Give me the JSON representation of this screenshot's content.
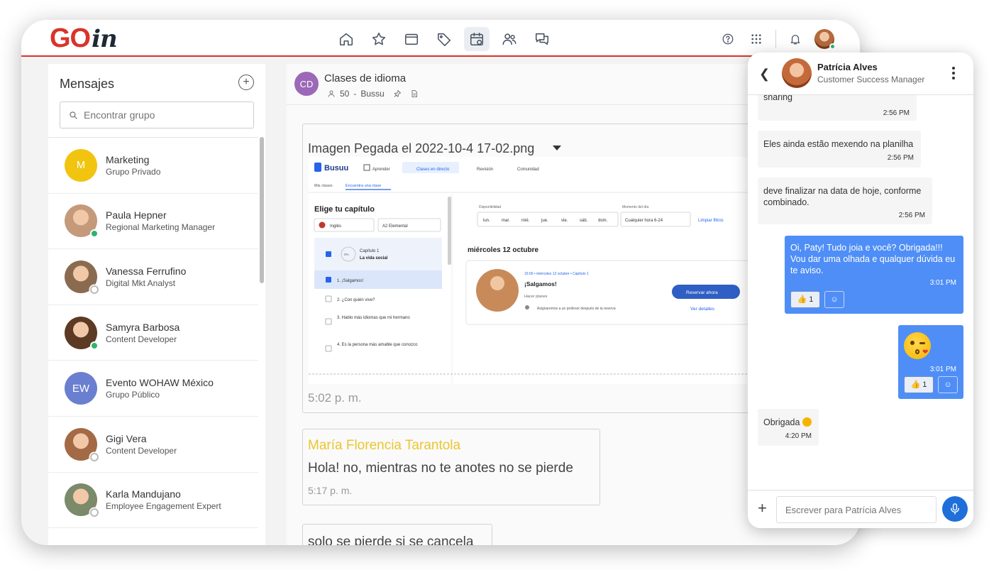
{
  "app": {
    "logo_go": "GO",
    "logo_in": "in",
    "nav": [
      "home-icon",
      "star-icon",
      "wallet-icon",
      "tag-icon",
      "calendar-icon",
      "people-icon",
      "chat-icon"
    ],
    "active_nav": "calendar-icon",
    "accent_color": "#d9342b"
  },
  "sidebar": {
    "title": "Mensajes",
    "search_placeholder": "Encontrar grupo",
    "items": [
      {
        "name": "Marketing",
        "sub": "Grupo Privado",
        "initials": "M",
        "color": "#f1c40f",
        "status": ""
      },
      {
        "name": "Paula Hepner",
        "sub": "Regional Marketing Manager",
        "initials": "",
        "color": "#c49a7a",
        "status": "online"
      },
      {
        "name": "Vanessa Ferrufino",
        "sub": "Digital Mkt Analyst",
        "initials": "",
        "color": "#8a6b4f",
        "status": "offline"
      },
      {
        "name": "Samyra Barbosa",
        "sub": "Content Developer",
        "initials": "",
        "color": "#5c3a24",
        "status": "online"
      },
      {
        "name": "Evento WOHAW México",
        "sub": "Grupo Público",
        "initials": "EW",
        "color": "#6a7fcf",
        "status": ""
      },
      {
        "name": "Gigi Vera",
        "sub": "Content Developer",
        "initials": "",
        "color": "#a36a45",
        "status": "offline"
      },
      {
        "name": "Karla Mandujano",
        "sub": "Employee Engagement Expert",
        "initials": "",
        "color": "#7b8a6a",
        "status": "offline"
      }
    ]
  },
  "conversation": {
    "avatar": "CD",
    "title": "Clases de idioma",
    "members": "50",
    "separator": "-",
    "partner": "Bussu",
    "image_message": {
      "filename": "Imagen Pegada el 2022-10-4 17-02.png",
      "time": "5:02 p. m.",
      "shot": {
        "brand": "Busuu",
        "tabs": [
          "Aprender",
          "Clases en directo",
          "Revisión",
          "Comunidad"
        ],
        "subtabs": [
          "Mis clases",
          "Encuentra una clase"
        ],
        "heading": "Elige tu capítulo",
        "lang": "Inglés",
        "level": "A2 Elemental",
        "chapter_pct": "0%",
        "chapter_title": "Capítulo 1",
        "chapter_sub": "La vida social",
        "lessons": [
          "1. ¡Salgamos!",
          "2. ¿Con quién vive?",
          "3. Hablo más idiomas que mi hermano",
          "4. Es la persona más amable que conozco"
        ],
        "filter_label_1": "Disponibilidad",
        "filter_label_2": "Momento del día",
        "days": [
          "lun.",
          "mar.",
          "mié.",
          "jue.",
          "vie.",
          "sáb.",
          "dom."
        ],
        "time_select": "Cualquier hora 6-24",
        "clear": "Limpiar filtros",
        "date": "miércoles 12 octubre",
        "class_meta": "16:00 • miércoles 12 octubre • Capítulo 1",
        "class_title": "¡Salgamos!",
        "class_sub": "Hacer planes",
        "class_note": "Asignaremos a un profesor después de la reserva",
        "book": "Reservar ahora",
        "details": "Ver detalles"
      }
    },
    "message2": {
      "author": "María Florencia Tarantola",
      "text": "Hola! no, mientras no te anotes no se pierde",
      "time": "5:17 p. m."
    },
    "message3": {
      "text": "solo se pierde si se cancela"
    }
  },
  "chat": {
    "name": "Patrícia Alves",
    "role": "Customer Success Manager",
    "input_placeholder": "Escrever para Patrícia Alves",
    "messages": [
      {
        "text": "sharing",
        "time": "2:56 PM",
        "mine": false
      },
      {
        "text": "Eles ainda estão mexendo na planilha",
        "time": "2:56 PM",
        "mine": false
      },
      {
        "text": "deve finalizar na data de hoje, conforme combinado.",
        "time": "2:56 PM",
        "mine": false
      },
      {
        "text": "Oi, Paty! Tudo joia e você? Obrigada!!! Vou dar uma olhada e qualquer dúvida eu te aviso.",
        "time": "3:01 PM",
        "mine": true,
        "reaction_count": "1"
      },
      {
        "text": "",
        "time": "3:01 PM",
        "mine": true,
        "reaction_count": "1",
        "emoji": "kiss"
      },
      {
        "text": "Obrigada",
        "time": "4:20 PM",
        "mine": false
      }
    ]
  }
}
